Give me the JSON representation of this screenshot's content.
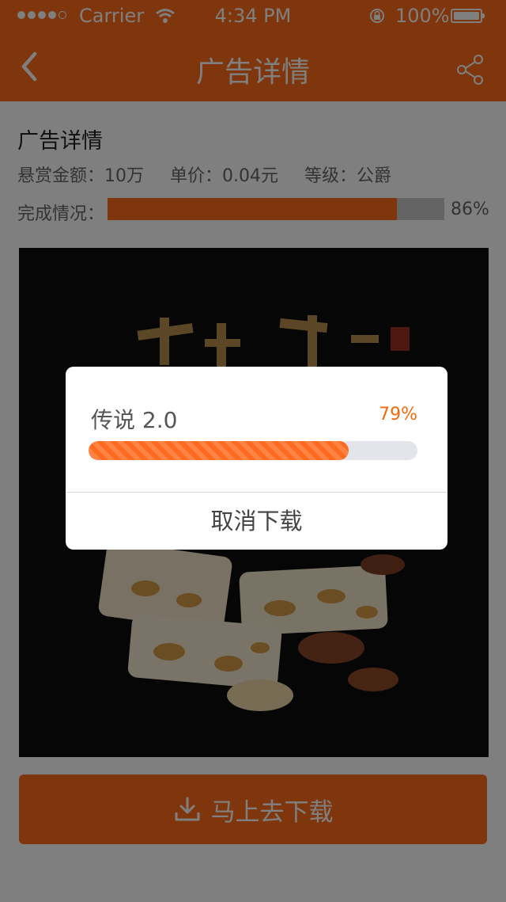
{
  "status_bar": {
    "carrier": "Carrier",
    "time": "4:34 PM",
    "battery": "100%"
  },
  "nav": {
    "title": "广告详情"
  },
  "ad": {
    "section_title": "广告详情",
    "reward": "悬赏金额：10万",
    "unit_price": "单价：0.04元",
    "level": "等级：公爵",
    "progress_label": "完成情况：",
    "progress_pct_text": "86%",
    "progress_value": 0.86
  },
  "cta": {
    "label": "马上去下载"
  },
  "dialog": {
    "app_name": "传说 2.0",
    "percent_text": "79%",
    "progress_value": 0.79,
    "cancel_label": "取消下载"
  },
  "colors": {
    "accent": "#ff6c1b",
    "dialog_accent": "#f26a10"
  }
}
